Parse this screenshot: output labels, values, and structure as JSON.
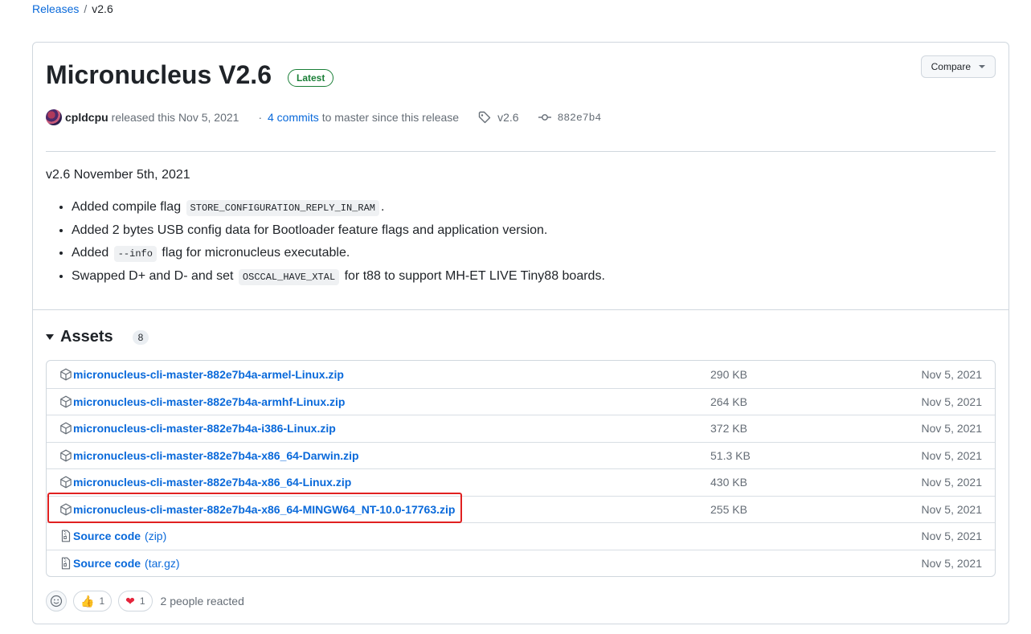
{
  "breadcrumb": {
    "parent": "Releases",
    "separator": "/",
    "current": "v2.6"
  },
  "release": {
    "title": "Micronucleus V2.6",
    "badge": "Latest",
    "compare_label": "Compare",
    "author": "cpldcpu",
    "released_text": "released this Nov 5, 2021",
    "commits_prefix": "·",
    "commits_link": "4 commits",
    "commits_suffix": "to master since this release",
    "tag": "v2.6",
    "commit_hash": "882e7b4"
  },
  "notes": {
    "heading": "v2.6 November 5th, 2021",
    "items": [
      {
        "before": "Added compile flag",
        "code": "STORE_CONFIGURATION_REPLY_IN_RAM",
        "after": "."
      },
      {
        "before": "Added 2 bytes USB config data for Bootloader feature flags and application version.",
        "code": "",
        "after": ""
      },
      {
        "before": "Added",
        "code": "--info",
        "after": "flag for micronucleus executable."
      },
      {
        "before": "Swapped D+ and D- and set",
        "code": "OSCCAL_HAVE_XTAL",
        "after": "for t88 to support MH-ET LIVE Tiny88 boards."
      }
    ]
  },
  "assets": {
    "title": "Assets",
    "count": "8",
    "rows": [
      {
        "name": "micronucleus-cli-master-882e7b4a-armel-Linux.zip",
        "ext": "",
        "size": "290 KB",
        "date": "Nov 5, 2021",
        "icon": "package-icon"
      },
      {
        "name": "micronucleus-cli-master-882e7b4a-armhf-Linux.zip",
        "ext": "",
        "size": "264 KB",
        "date": "Nov 5, 2021",
        "icon": "package-icon"
      },
      {
        "name": "micronucleus-cli-master-882e7b4a-i386-Linux.zip",
        "ext": "",
        "size": "372 KB",
        "date": "Nov 5, 2021",
        "icon": "package-icon"
      },
      {
        "name": "micronucleus-cli-master-882e7b4a-x86_64-Darwin.zip",
        "ext": "",
        "size": "51.3 KB",
        "date": "Nov 5, 2021",
        "icon": "package-icon"
      },
      {
        "name": "micronucleus-cli-master-882e7b4a-x86_64-Linux.zip",
        "ext": "",
        "size": "430 KB",
        "date": "Nov 5, 2021",
        "icon": "package-icon"
      },
      {
        "name": "micronucleus-cli-master-882e7b4a-x86_64-MINGW64_NT-10.0-17763.zip",
        "ext": "",
        "size": "255 KB",
        "date": "Nov 5, 2021",
        "icon": "package-icon"
      },
      {
        "name": "Source code",
        "ext": "(zip)",
        "size": "",
        "date": "Nov 5, 2021",
        "icon": "file-zip-icon"
      },
      {
        "name": "Source code",
        "ext": "(tar.gz)",
        "size": "",
        "date": "Nov 5, 2021",
        "icon": "file-zip-icon"
      }
    ]
  },
  "reactions": {
    "thumbs_up_count": "1",
    "heart_count": "1",
    "summary": "2 people reacted"
  },
  "colors": {
    "link": "#0969da",
    "latest": "#1a7f37",
    "highlight": "#e02020",
    "border": "#d0d7de"
  }
}
